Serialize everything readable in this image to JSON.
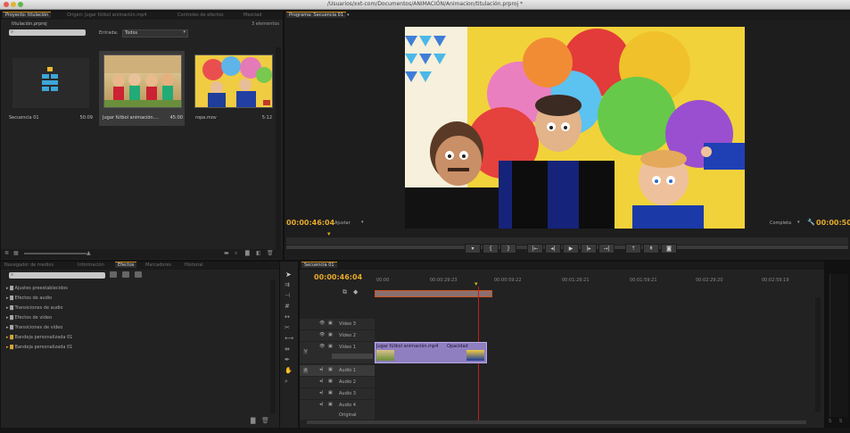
{
  "window": {
    "title": "/Usuarios/xxt-com/Documentos/ANIMACIÓN/Animacion/titulación.prproj *"
  },
  "project": {
    "tabs": [
      "Proyecto: titulación",
      "Origen: Jugar fútbol animación.mp4",
      "Controles de efectos",
      "Mezclad"
    ],
    "file": "titulación.prproj",
    "count": "3 elementos",
    "filter_label": "Entrada:",
    "filter_value": "Todos",
    "items": [
      {
        "name": "Secuencia 01",
        "duration": "50:09"
      },
      {
        "name": "Jugar fútbol animación....",
        "duration": "45:00"
      },
      {
        "name": "ropa.mov",
        "duration": "5:12"
      }
    ]
  },
  "program": {
    "tab": "Programa: Secuencia 01",
    "timecode": "00:00:46:04",
    "fit": "Ajustar",
    "quality": "Completa",
    "end_timecode": "00:00:50"
  },
  "effects": {
    "tabs": [
      "Navegador de medios",
      "Información",
      "Efectos",
      "Marcadores",
      "Historial"
    ],
    "items": [
      "Ajustes preestablecidos",
      "Efectos de audio",
      "Transiciones de audio",
      "Efectos de vídeo",
      "Transiciones de vídeo",
      "Bandeja personalizada 01",
      "Bandeja personalizada 01"
    ]
  },
  "timeline": {
    "tab": "Secuencia 01",
    "timecode": "00:00:46:04",
    "ruler": [
      "00:00",
      "00:00:29:23",
      "00:00:59:22",
      "00:01:29:21",
      "00:01:59:21",
      "00:02:29:20",
      "00:02:59:19"
    ],
    "video_tracks": [
      "Vídeo 3",
      "Vídeo 2",
      "Vídeo 1"
    ],
    "audio_tracks": [
      "Audio 1",
      "Audio 2",
      "Audio 3",
      "Audio 4"
    ],
    "master": "Original",
    "clip": "Jugar fútbol animación.mp4",
    "clip_fx": "Opacidad"
  },
  "colors": {
    "accent": "#c58a19",
    "playhead": "#e0b020",
    "clip": "#8f7fc0",
    "cutline": "#c02020"
  }
}
